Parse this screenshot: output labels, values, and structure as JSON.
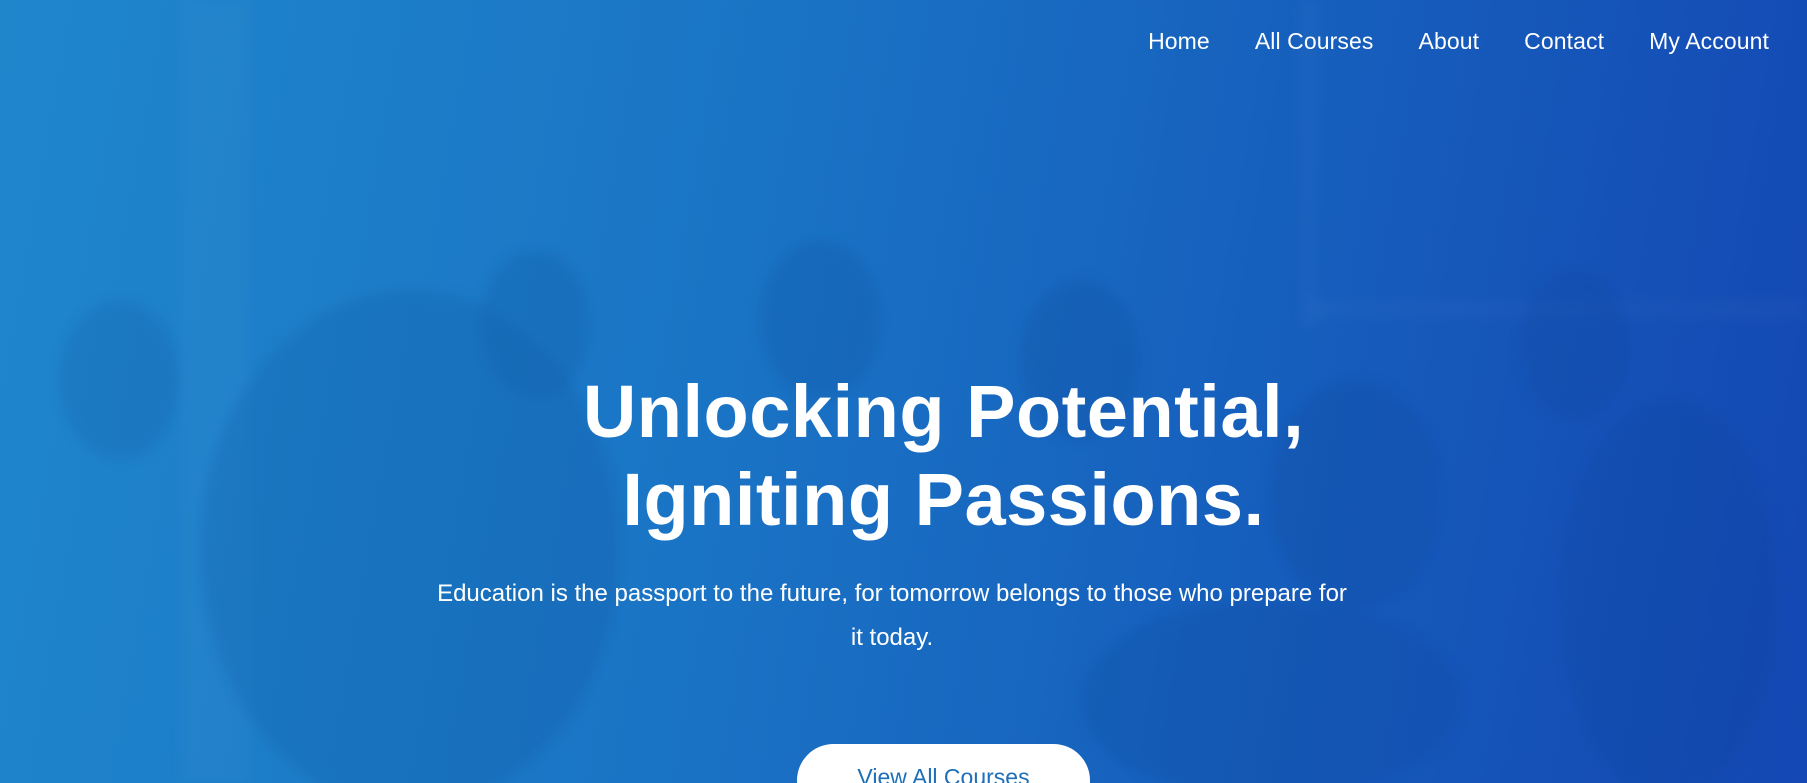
{
  "nav": {
    "items": [
      {
        "label": "Home"
      },
      {
        "label": "All Courses"
      },
      {
        "label": "About"
      },
      {
        "label": "Contact"
      },
      {
        "label": "My Account"
      }
    ]
  },
  "hero": {
    "title_line1": "Unlocking Potential,",
    "title_line2": "Igniting Passions.",
    "subtitle_line1": "Education is the passport to the future, for tomorrow belongs to those who prepare for",
    "subtitle_line2": "it today.",
    "cta_label": "View All Courses"
  },
  "colors": {
    "gradient_start": "#1f86cc",
    "gradient_end": "#1448b3",
    "cta_text": "#1d6fb8",
    "cta_background": "#ffffff"
  }
}
